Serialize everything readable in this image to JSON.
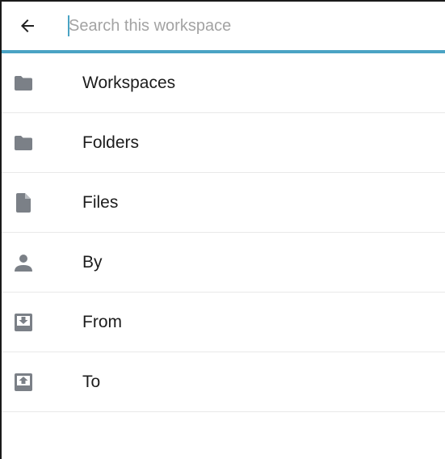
{
  "search": {
    "placeholder": "Search this workspace",
    "value": ""
  },
  "colors": {
    "accent": "#4aa3c4",
    "icon": "#7b8087",
    "text": "#1c1c1c",
    "divider": "#e9e9e9"
  },
  "filters": [
    {
      "label": "Workspaces",
      "icon": "folder-open-icon"
    },
    {
      "label": "Folders",
      "icon": "folder-icon"
    },
    {
      "label": "Files",
      "icon": "file-icon"
    },
    {
      "label": "By",
      "icon": "person-icon"
    },
    {
      "label": "From",
      "icon": "inbox-in-icon"
    },
    {
      "label": "To",
      "icon": "inbox-out-icon"
    }
  ]
}
